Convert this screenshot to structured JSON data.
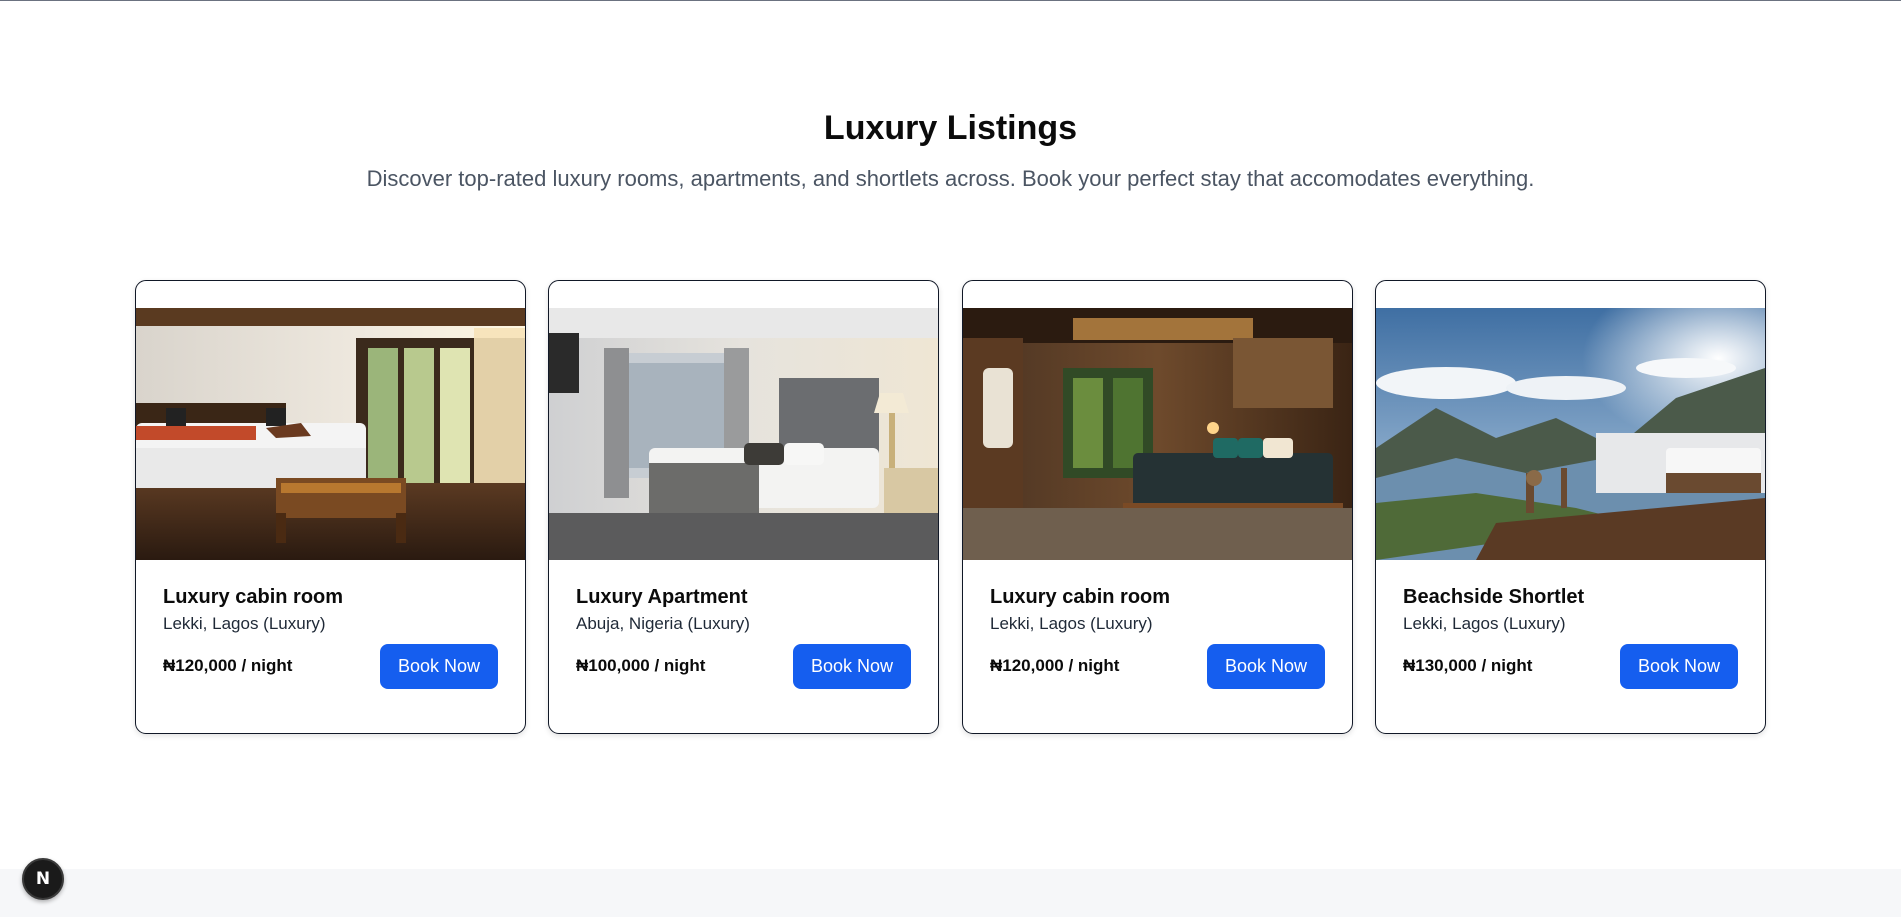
{
  "header": {
    "title": "Luxury Listings",
    "subtitle": "Discover top-rated luxury rooms, apartments, and shortlets across. Book your perfect stay that accomodates everything."
  },
  "listings": [
    {
      "name": "Luxury cabin room",
      "location": "Lekki, Lagos (Luxury)",
      "price": "₦120,000 / night",
      "button": "Book Now",
      "image": "bedroom-with-wooden-bench-photo"
    },
    {
      "name": "Luxury Apartment",
      "location": "Abuja, Nigeria (Luxury)",
      "price": "₦100,000 / night",
      "button": "Book Now",
      "image": "hotel-bedroom-photo"
    },
    {
      "name": "Luxury cabin room",
      "location": "Lekki, Lagos (Luxury)",
      "price": "₦120,000 / night",
      "button": "Book Now",
      "image": "warm-lit-bedroom-photo"
    },
    {
      "name": "Beachside Shortlet",
      "location": "Lekki, Lagos (Luxury)",
      "price": "₦130,000 / night",
      "button": "Book Now",
      "image": "mountain-deck-bed-photo"
    }
  ],
  "dev_badge": {
    "letter": "N",
    "icon": "nextjs-logo-icon"
  },
  "colors": {
    "accent": "#155eef",
    "title": "#0b0b0b",
    "subtitle": "#4b5563"
  }
}
